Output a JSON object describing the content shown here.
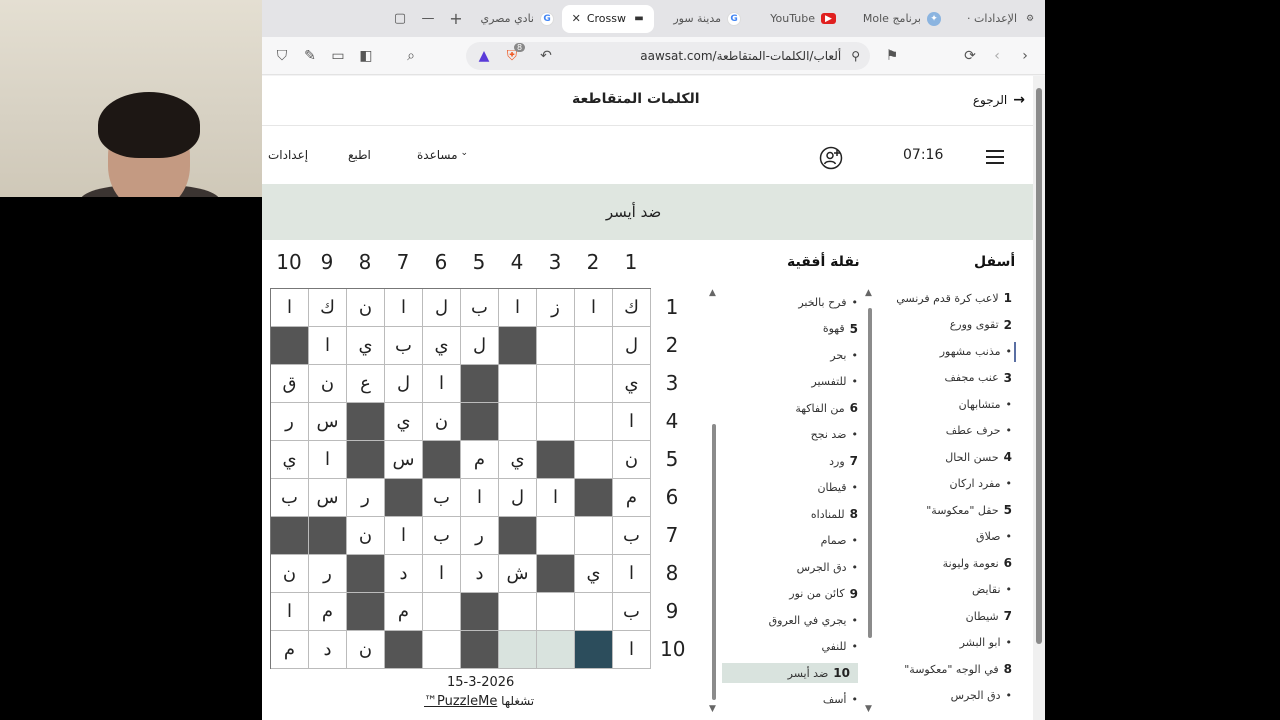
{
  "tabs": [
    {
      "label": "الإعدادات ·",
      "icon": "gear-icon"
    },
    {
      "label": "برنامج Mole",
      "icon": "mole-icon"
    },
    {
      "label": "YouTube",
      "icon": "youtube-icon"
    },
    {
      "label": "مدينة سور",
      "icon": "google-icon"
    },
    {
      "label": "Crossw",
      "icon": "aawsat-icon",
      "active": true
    },
    {
      "label": "نادي مصري",
      "icon": "google-icon"
    }
  ],
  "address": {
    "url": "aawsat.com/ألعاب/الكلمات-المتقاطعة",
    "shield_count": "8"
  },
  "header": {
    "title": "الكلمات المتقاطعة",
    "back": "الرجوع"
  },
  "menu": {
    "settings": "إعدادات",
    "print": "اطبع",
    "help": "مساعدة",
    "timer": "07:16"
  },
  "current_clue": "ضد أيسر",
  "grid": {
    "col_numbers": [
      "10",
      "9",
      "8",
      "7",
      "6",
      "5",
      "4",
      "3",
      "2",
      "1"
    ],
    "row_numbers": [
      "1",
      "2",
      "3",
      "4",
      "5",
      "6",
      "7",
      "8",
      "9",
      "10"
    ],
    "rows": [
      [
        "ك",
        "ا",
        "ز",
        "ا",
        "ب",
        "ل",
        "ا",
        "ن",
        "ك",
        "ا"
      ],
      [
        "ل",
        "",
        "",
        "#",
        "ل",
        "ي",
        "ب",
        "ي",
        "ا",
        "#"
      ],
      [
        "ي",
        "",
        "",
        "",
        "#",
        "ا",
        "ل",
        "ع",
        "ن",
        "ق"
      ],
      [
        "ا",
        "",
        "",
        "",
        "#",
        "ن",
        "ي",
        "#",
        "س",
        "ر"
      ],
      [
        "ن",
        "",
        "#",
        "ي",
        "م",
        "#",
        "س",
        "#",
        "ا",
        "ي"
      ],
      [
        "م",
        "#",
        "ا",
        "ل",
        "ا",
        "ب",
        "#",
        "ر",
        "س",
        "ب"
      ],
      [
        "ب",
        "",
        "",
        "#",
        "ر",
        "ب",
        "ا",
        "ن",
        "#",
        "#"
      ],
      [
        "ا",
        "ي",
        "#",
        "ش",
        "د",
        "ا",
        "د",
        "#",
        "ر",
        "ن"
      ],
      [
        "ب",
        "",
        "",
        "",
        "#",
        "",
        "م",
        "#",
        "م",
        "ا"
      ],
      [
        "ا",
        "@",
        "+",
        "+",
        "#",
        "",
        "#",
        "ن",
        "د",
        "م"
      ]
    ],
    "date": "15-3-2026",
    "credit_prefix": "تشغلها",
    "credit_brand": "PuzzleMe™"
  },
  "across": {
    "heading": "نقلة أفقية",
    "clues": [
      {
        "num": "",
        "text": "فرح بالخبر"
      },
      {
        "num": "5",
        "text": "قهوة"
      },
      {
        "num": "",
        "text": "بحر"
      },
      {
        "num": "",
        "text": "للتفسير"
      },
      {
        "num": "6",
        "text": "من الفاكهة"
      },
      {
        "num": "",
        "text": "ضد نجح"
      },
      {
        "num": "7",
        "text": "ورد"
      },
      {
        "num": "",
        "text": "قيطان"
      },
      {
        "num": "8",
        "text": "للمناداه"
      },
      {
        "num": "",
        "text": "صمام"
      },
      {
        "num": "",
        "text": "دق الجرس"
      },
      {
        "num": "9",
        "text": "كائن من نور"
      },
      {
        "num": "",
        "text": "يجري في العروق"
      },
      {
        "num": "",
        "text": "للنفي"
      },
      {
        "num": "10",
        "text": "ضد أيسر",
        "active": true
      },
      {
        "num": "",
        "text": "أسف"
      }
    ]
  },
  "down": {
    "heading": "أسفل",
    "clues": [
      {
        "num": "1",
        "text": "لاعب كرة قدم فرنسي"
      },
      {
        "num": "2",
        "text": "تقوى وورع"
      },
      {
        "num": "",
        "text": "مذنب مشهور"
      },
      {
        "num": "3",
        "text": "عنب مجفف"
      },
      {
        "num": "",
        "text": "متشابهان"
      },
      {
        "num": "",
        "text": "حرف عطف"
      },
      {
        "num": "4",
        "text": "حسن الحال"
      },
      {
        "num": "",
        "text": "مفرد اركان"
      },
      {
        "num": "5",
        "text": "حقل \"معكوسة\""
      },
      {
        "num": "",
        "text": "صلاق"
      },
      {
        "num": "6",
        "text": "نعومة وليونة"
      },
      {
        "num": "",
        "text": "نقايض"
      },
      {
        "num": "7",
        "text": "شيطان"
      },
      {
        "num": "",
        "text": "ابو البشر"
      },
      {
        "num": "8",
        "text": "في الوجه \"معكوسة\""
      },
      {
        "num": "",
        "text": "دق الجرس"
      }
    ]
  },
  "colors": {
    "highlight": "#d9e3de",
    "current": "#2c4d5c",
    "block": "#555555",
    "cluebar": "#dfe6e0"
  }
}
